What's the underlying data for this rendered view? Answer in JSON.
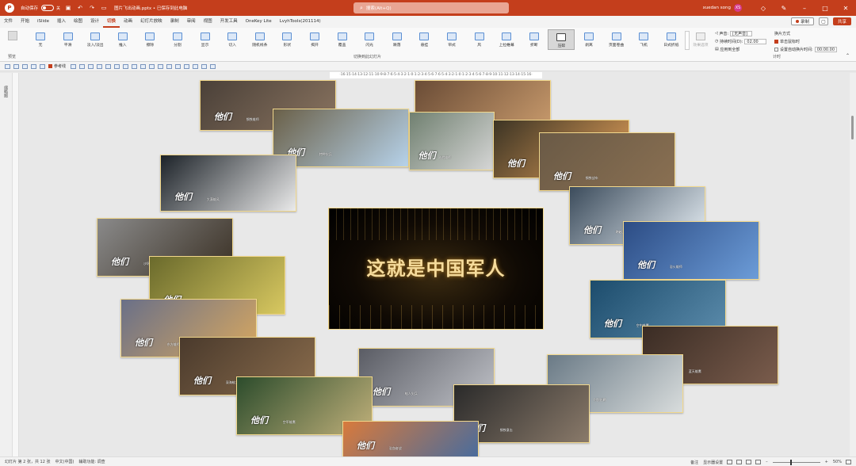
{
  "titlebar": {
    "autosave": "自动保存",
    "autosave_state": "关",
    "document": "图片飞出动画.pptx • 已保存到此电脑",
    "search_placeholder": "搜索(Alt+Q)",
    "user": "xuedan song",
    "user_initials": "XS"
  },
  "tabs": [
    "文件",
    "开始",
    "iSlide",
    "插入",
    "绘图",
    "设计",
    "切换",
    "动画",
    "幻灯片放映",
    "录制",
    "审阅",
    "视图",
    "开发工具",
    "OneKey Lite",
    "LvyhTools(201114)"
  ],
  "active_tab": "切换",
  "tab_buttons": {
    "record": "录制",
    "share": "共享"
  },
  "ribbon": {
    "preview_label": "预览",
    "group_label": "切换到此幻灯片",
    "timing_label": "计时",
    "transitions": [
      "无",
      "平滑",
      "淡入/淡出",
      "推入",
      "擦除",
      "分割",
      "显示",
      "切入",
      "随机线条",
      "形状",
      "揭开",
      "覆盖",
      "闪光",
      "跌落",
      "悬挂",
      "帘式",
      "风",
      "上拉帷幕",
      "折断",
      "压碎",
      "剥离",
      "页面卷曲",
      "飞机",
      "日式折纸"
    ],
    "selected_transition": "压碎",
    "effect_options": "效果选项",
    "sound_label": "声音:",
    "sound_value": "[无声音]",
    "duration_label": "持续时间(D):",
    "duration_value": "02.00",
    "apply_all": "应用到全部",
    "advance_label": "换片方式",
    "on_click": "单击鼠标时",
    "after_label": "设置自动换片时间:",
    "after_value": "00:00.00"
  },
  "qat": {
    "guides": "参考线"
  },
  "ruler": "·16·15·14·13·12·11·10·9·8·7·6·5·4·3·2·1·0·1·2·3·4·5·6·7·6·5·4·3·2·1·0·1·2·3·4·5·6·7·8·9·10·11·12·13·14·15·16·",
  "left_pane": "缩略图",
  "slide": {
    "center_title": "这就是中国军人",
    "photo_logo": "他们",
    "captions": [
      "钢铁雄师",
      "全军出击",
      "特种尖兵",
      "陆战雄师",
      "雪原雄鹰",
      "钢铁战车",
      "大漠雄风",
      "跨越天险",
      "沙场尖兵",
      "浴火雄师",
      "海上雄鹰",
      "空中雄鹰",
      "东方雄师",
      "蓝天雄鹰",
      "深海蛟龙",
      "蛙人尖兵",
      "利剑出鞘",
      "空军雄鹰",
      "钢铁意志",
      "浴血奋战"
    ]
  },
  "status": {
    "slide_info": "幻灯片 第 2 张，共 12 张",
    "language": "中文(中国)",
    "accessibility": "辅助功能: 调查",
    "notes": "备注",
    "display": "显示器设置",
    "zoom": "50%"
  }
}
